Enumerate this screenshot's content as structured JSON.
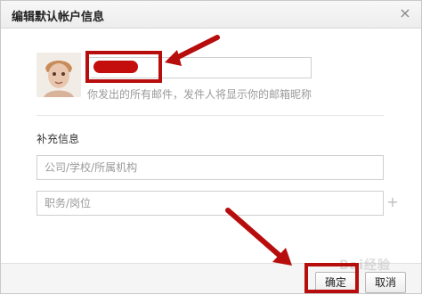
{
  "dialog": {
    "title": "编辑默认帐户信息",
    "close_icon": "close-icon"
  },
  "profile": {
    "avatar_icon": "avatar-icon",
    "name_value": "",
    "hint": "你发出的所有邮件，发件人将显示你的邮箱昵称"
  },
  "extra": {
    "label": "补充信息",
    "org_placeholder": "公司/学校/所属机构",
    "position_placeholder": "职务/岗位",
    "add_icon": "plus-icon"
  },
  "footer": {
    "ok_label": "确定",
    "cancel_label": "取消"
  },
  "watermark": "Bai经验"
}
